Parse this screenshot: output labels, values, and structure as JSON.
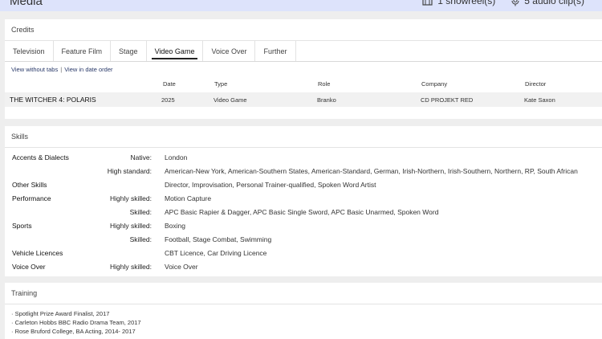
{
  "media": {
    "title": "Media",
    "showreel": "1 showreel(s)",
    "audio": "5 audio clip(s)"
  },
  "credits": {
    "title": "Credits",
    "tabs": [
      "Television",
      "Feature Film",
      "Stage",
      "Video Game",
      "Voice Over",
      "Further"
    ],
    "active_tab": "Video Game",
    "view_without_tabs": "View without tabs",
    "view_in_date_order": "View in date order",
    "columns": [
      "Date",
      "Type",
      "Role",
      "Company",
      "Director"
    ],
    "rows": [
      {
        "production": "THE WITCHER 4: POLARIS",
        "date": "2025",
        "type": "Video Game",
        "role": "Branko",
        "company": "CD PROJEKT RED",
        "director": "Kate Saxon"
      }
    ]
  },
  "skills": {
    "title": "Skills",
    "rows": [
      {
        "category": "Accents & Dialects",
        "level": "Native:",
        "value": "London"
      },
      {
        "category": "",
        "level": "High standard:",
        "value": "American-New York, American-Southern States, American-Standard, German, Irish-Northern, Irish-Southern, Northern, RP, South African"
      },
      {
        "category": "Other Skills",
        "level": "",
        "value": "Director, Improvisation, Personal Trainer-qualified, Spoken Word Artist"
      },
      {
        "category": "Performance",
        "level": "Highly skilled:",
        "value": "Motion Capture"
      },
      {
        "category": "",
        "level": "Skilled:",
        "value": "APC Basic Rapier & Dagger, APC Basic Single Sword, APC Basic Unarmed, Spoken Word"
      },
      {
        "category": "Sports",
        "level": "Highly skilled:",
        "value": "Boxing"
      },
      {
        "category": "",
        "level": "Skilled:",
        "value": "Football, Stage Combat, Swimming"
      },
      {
        "category": "Vehicle Licences",
        "level": "",
        "value": "CBT Licence, Car Driving Licence"
      },
      {
        "category": "Voice Over",
        "level": "Highly skilled:",
        "value": "Voice Over"
      }
    ]
  },
  "training": {
    "title": "Training",
    "items": [
      "· Spotlight Prize Award Finalist, 2017",
      "· Carleton Hobbs BBC Radio Drama Team, 2017",
      "· Rose Bruford College, BA Acting, 2014- 2017"
    ]
  }
}
